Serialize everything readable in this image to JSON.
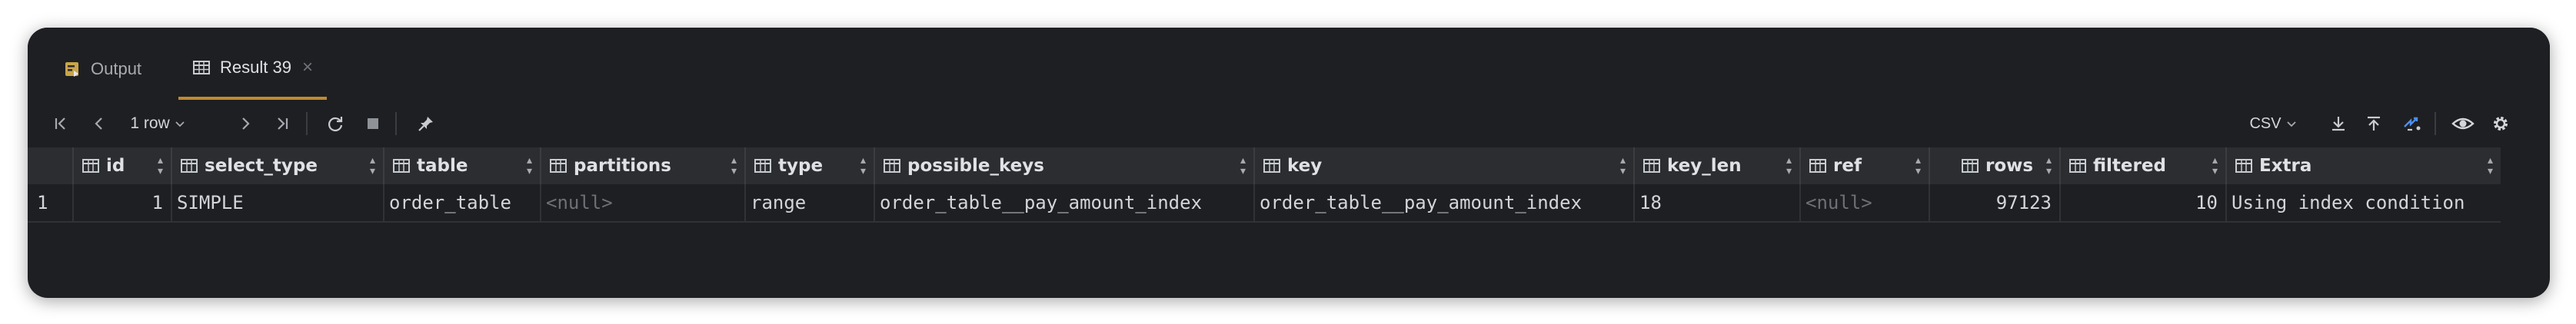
{
  "tabs": [
    {
      "label": "Output",
      "icon": "output-log-icon",
      "active": false
    },
    {
      "label": "Result 39",
      "icon": "table-grid-icon",
      "active": true,
      "close": "×"
    }
  ],
  "toolbar": {
    "rows_label": "1 row",
    "format_label": "CSV"
  },
  "grid": {
    "columns": [
      "id",
      "select_type",
      "table",
      "partitions",
      "type",
      "possible_keys",
      "key",
      "key_len",
      "ref",
      "rows",
      "filtered",
      "Extra"
    ],
    "rows": [
      {
        "row_number": "1",
        "cells": [
          "1",
          "SIMPLE",
          "order_table",
          "<null>",
          "range",
          "order_table__pay_amount_index",
          "order_table__pay_amount_index",
          "18",
          "<null>",
          "97123",
          "10",
          "Using index condition"
        ]
      }
    ]
  },
  "colors": {
    "window_bg": "#1e1f22",
    "header_bg": "#2b2d30",
    "active_tab_underline": "#c08a2e",
    "null_text": "#6d7076",
    "accent_blue": "#4d8ef0"
  }
}
